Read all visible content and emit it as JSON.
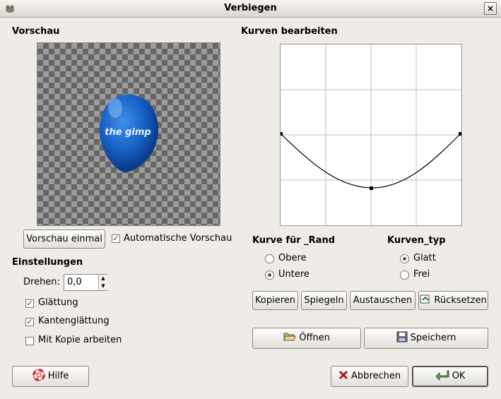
{
  "window": {
    "title": "Verbiegen",
    "close_label": "×"
  },
  "preview": {
    "heading": "Vorschau",
    "once_button": "Vorschau einmal",
    "auto_label": "Automatische Vorschau",
    "auto_checked": true
  },
  "settings": {
    "heading": "Einstellungen",
    "rotate_label": "Drehen:",
    "rotate_value": "0,0",
    "smoothing_label": "Glättung",
    "smoothing_checked": true,
    "antialias_label": "Kantenglättung",
    "antialias_checked": true,
    "copy_label": "Mit Kopie arbeiten",
    "copy_checked": false
  },
  "curve": {
    "heading": "Kurven bearbeiten"
  },
  "curve_for": {
    "heading": "Kurve für _Rand",
    "upper": "Obere",
    "lower": "Untere",
    "selected": "lower"
  },
  "curve_type": {
    "heading": "Kurven_typ",
    "smooth": "Glatt",
    "free": "Frei",
    "selected": "smooth"
  },
  "actions": {
    "copy": "Kopieren",
    "mirror": "Spiegeln",
    "swap": "Austauschen",
    "reset": "Rücksetzen",
    "open": "Öffnen",
    "save": "Speichern"
  },
  "footer": {
    "help": "Hilfe",
    "cancel": "Abbrechen",
    "ok": "OK"
  },
  "balloon_text": "the gimp"
}
